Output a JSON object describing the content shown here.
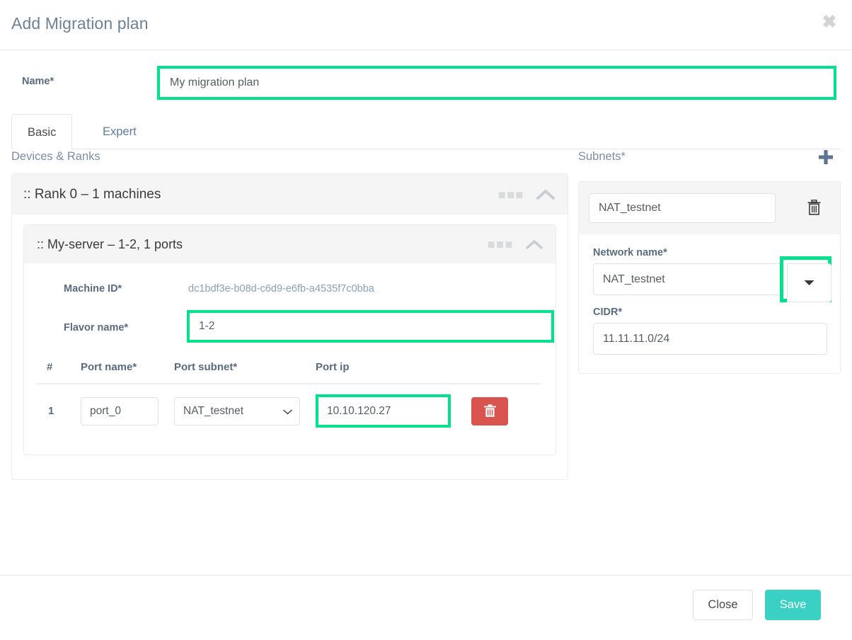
{
  "modal": {
    "title": "Add Migration plan",
    "close_icon": "close-x-icon"
  },
  "name_field": {
    "label": "Name*",
    "value": "My migration plan",
    "placeholder": "Name"
  },
  "tabs": [
    {
      "label": "Basic",
      "active": true
    },
    {
      "label": "Expert",
      "active": false
    }
  ],
  "devices": {
    "section_title": "Devices & Ranks",
    "rank": {
      "title": ":: Rank 0 – 1 machines",
      "menu_icon": "ellipsis-icon",
      "collapse_icon": "chevron-up-icon"
    },
    "server": {
      "title": ":: My-server – 1-2, 1 ports",
      "menu_icon": "ellipsis-icon",
      "collapse_icon": "chevron-up-icon",
      "machine_id_label": "Machine ID*",
      "machine_id_value": "dc1bdf3e-b08d-c6d9-e6fb-a4535f7c0bba",
      "flavor_label": "Flavor name*",
      "flavor_value": "1-2"
    },
    "ports_table": {
      "headers": [
        "#",
        "Port name*",
        "Port subnet*",
        "Port ip"
      ],
      "rows": [
        {
          "num": "1",
          "port_name": "port_0",
          "port_subnet": "NAT_testnet",
          "port_ip": "10.10.120.27",
          "delete_icon": "trash-icon"
        }
      ]
    }
  },
  "subnets": {
    "section_title": "Subnets*",
    "add_icon": "plus-icon",
    "card": {
      "subnet_name": "NAT_testnet",
      "delete_icon": "trash-icon",
      "network_name_label": "Network name*",
      "network_name_value": "NAT_testnet",
      "dropdown_icon": "caret-down-icon",
      "cidr_label": "CIDR*",
      "cidr_value": "11.11.11.0/24"
    }
  },
  "footer": {
    "close_label": "Close",
    "save_label": "Save"
  },
  "colors": {
    "highlight": "#00e28c",
    "save": "#3ad1c4",
    "danger": "#d9534f",
    "title": "#6e8199"
  }
}
